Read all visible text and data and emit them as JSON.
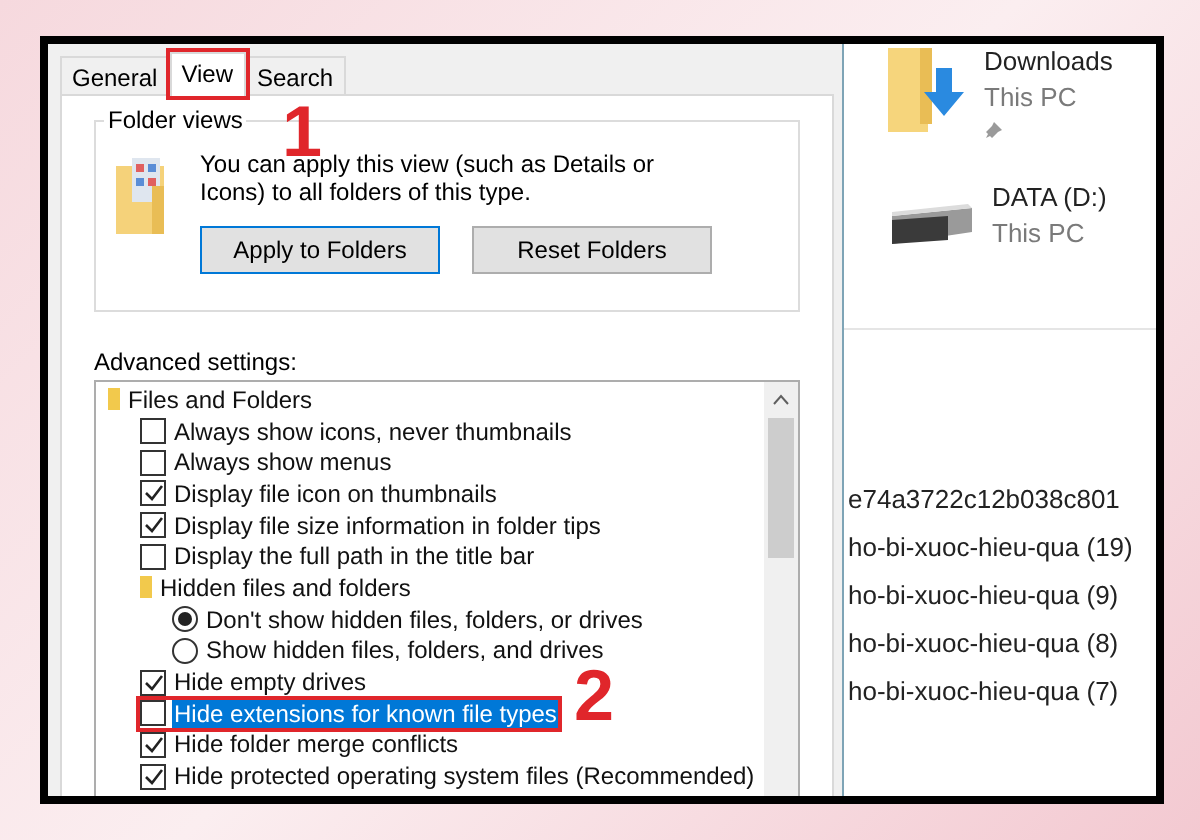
{
  "dialog": {
    "tabs": [
      {
        "label": "General",
        "selected": false,
        "marked": false
      },
      {
        "label": "View",
        "selected": true,
        "marked": true
      },
      {
        "label": "Search",
        "selected": false,
        "marked": false
      }
    ],
    "folder_views": {
      "title": "Folder views",
      "text": "You can apply this view (such as Details or Icons) to all folders of this type.",
      "buttons": [
        {
          "label": "Apply to Folders",
          "focused": true
        },
        {
          "label": "Reset Folders",
          "focused": false
        }
      ]
    },
    "advanced_label": "Advanced settings:",
    "settings": [
      {
        "kind": "folder",
        "label": "Files and Folders",
        "selected": false,
        "marked": false,
        "children": [
          {
            "kind": "checkbox",
            "label": "Always show icons, never thumbnails",
            "checked": false,
            "selected": false,
            "marked": false
          },
          {
            "kind": "checkbox",
            "label": "Always show menus",
            "checked": false,
            "selected": false,
            "marked": false
          },
          {
            "kind": "checkbox",
            "label": "Display file icon on thumbnails",
            "checked": true,
            "selected": false,
            "marked": false
          },
          {
            "kind": "checkbox",
            "label": "Display file size information in folder tips",
            "checked": true,
            "selected": false,
            "marked": false
          },
          {
            "kind": "checkbox",
            "label": "Display the full path in the title bar",
            "checked": false,
            "selected": false,
            "marked": false
          },
          {
            "kind": "folder",
            "label": "Hidden files and folders",
            "selected": false,
            "marked": false,
            "children": [
              {
                "kind": "radio",
                "label": "Don't show hidden files, folders, or drives",
                "checked": true,
                "selected": false,
                "marked": false
              },
              {
                "kind": "radio",
                "label": "Show hidden files, folders, and drives",
                "checked": false,
                "selected": false,
                "marked": false
              }
            ]
          },
          {
            "kind": "checkbox",
            "label": "Hide empty drives",
            "checked": true,
            "selected": false,
            "marked": false
          },
          {
            "kind": "checkbox",
            "label": "Hide extensions for known file types",
            "checked": false,
            "selected": true,
            "marked": true
          },
          {
            "kind": "checkbox",
            "label": "Hide folder merge conflicts",
            "checked": true,
            "selected": false,
            "marked": false
          },
          {
            "kind": "checkbox",
            "label": "Hide protected operating system files (Recommended)",
            "checked": true,
            "selected": false,
            "marked": false
          }
        ]
      }
    ]
  },
  "explorer": {
    "locations": [
      {
        "kind": "downloads",
        "name": "Downloads",
        "location": "This PC",
        "pinned": true
      },
      {
        "kind": "drive",
        "name": "DATA (D:)",
        "location": "This PC",
        "pinned": false
      }
    ],
    "files": [
      "e74a3722c12b038c801",
      "ho-bi-xuoc-hieu-qua (19)",
      "ho-bi-xuoc-hieu-qua (9)",
      "ho-bi-xuoc-hieu-qua (8)",
      "ho-bi-xuoc-hieu-qua (7)"
    ]
  },
  "annotations": [
    {
      "label": "1"
    },
    {
      "label": "2"
    }
  ]
}
